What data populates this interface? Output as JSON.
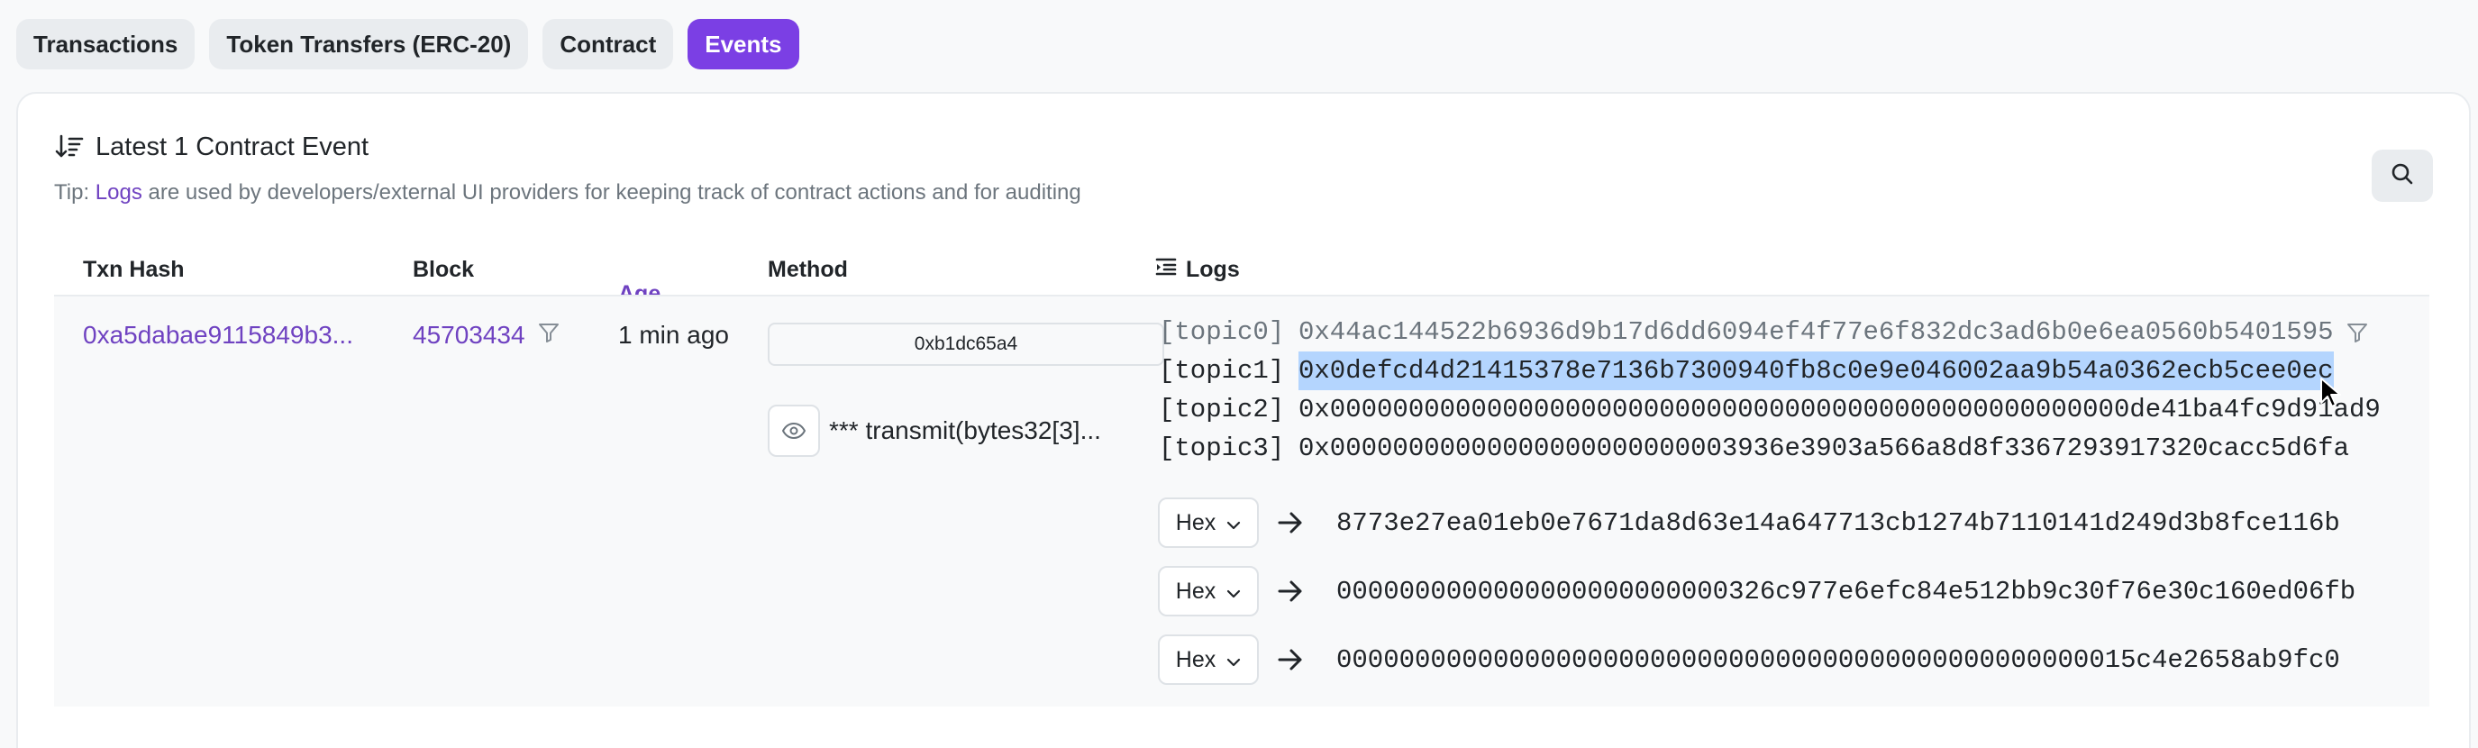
{
  "tabs": [
    {
      "label": "Transactions",
      "active": false
    },
    {
      "label": "Token Transfers (ERC-20)",
      "active": false
    },
    {
      "label": "Contract",
      "active": false
    },
    {
      "label": "Events",
      "active": true
    }
  ],
  "section": {
    "title": "Latest 1 Contract Event",
    "tip_prefix": "Tip: ",
    "tip_link": "Logs",
    "tip_suffix": " are used by developers/external UI providers for keeping track of contract actions and for auditing"
  },
  "table": {
    "headers": {
      "txn_hash": "Txn Hash",
      "block": "Block",
      "age": "Age",
      "method": "Method",
      "logs": "Logs"
    },
    "row": {
      "txn_hash": "0xa5dabae9115849b3...",
      "block": "45703434",
      "age": "1 min ago",
      "method_id": "0xb1dc65a4",
      "method_signature": "*** transmit(bytes32[3]...",
      "topics": [
        {
          "label": "[topic0]",
          "value": "0x44ac144522b6936d9b17d6dd6094ef4f77e6f832dc3ad6b0e6ea0560b5401595"
        },
        {
          "label": "[topic1]",
          "value": "0x0defcd4d21415378e7136b7300940fb8c0e9e046002aa9b54a0362ecb5cee0ec"
        },
        {
          "label": "[topic2]",
          "value": "0x000000000000000000000000000000000000000000000000000de41ba4fc9d91ad9"
        },
        {
          "label": "[topic3]",
          "value": "0x00000000000000000000000003936e3903a566a8d8f3367293917320cacc5d6fa"
        }
      ],
      "data": [
        {
          "format": "Hex",
          "value": "8773e27ea01eb0e7671da8d63e14a647713cb1274b7110141d249d3b8fce116b"
        },
        {
          "format": "Hex",
          "value": "0000000000000000000000000326c977e6efc84e512bb9c30f76e30c160ed06fb"
        },
        {
          "format": "Hex",
          "value": "000000000000000000000000000000000000000000000000015c4e2658ab9fc0"
        }
      ]
    }
  },
  "colors": {
    "accent": "#7b3fe4",
    "link": "#6f42c1",
    "selection": "#b4d5fe"
  },
  "icons": [
    "sort-icon",
    "search-icon",
    "logs-icon",
    "filter-icon",
    "eye-icon",
    "chevron-down-icon",
    "arrow-right-icon",
    "mouse-cursor-icon"
  ]
}
